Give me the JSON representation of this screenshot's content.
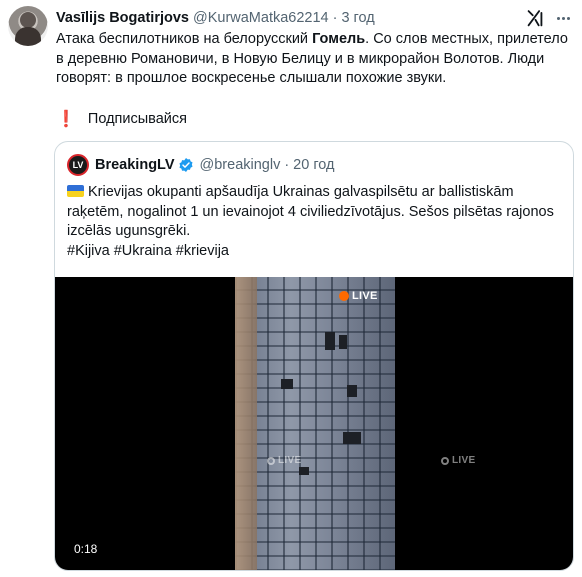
{
  "tweet": {
    "display_name": "Vasīlijs Bogatirjovs",
    "handle": "@KurwaMatka62214",
    "separator": "·",
    "time": "3 год",
    "text_part1": "Атака беспилотников на белорусский ",
    "text_bold": "Гомель",
    "text_part2": ". Со слов местных, прилетело в деревню Романовичи, в Новую Белицу и в микрорайон Волотов. Люди говорят: в прошлое воскресенье слышали похожие звуки.",
    "subscribe_icon": "❗",
    "subscribe_text": "Подписывайся"
  },
  "quote": {
    "display_name": "BreakingLV",
    "avatar_text": "LV",
    "handle": "@breakinglv",
    "separator": "·",
    "time": "20 год",
    "text": "Krievijas okupanti apšaudīja Ukrainas galvaspilsētu ar ballistiskām raķetēm, nogalinot 1 un ievainojot 4 civiliedzīvotājus. Sešos pilsētas rajonos izcēlās ugunsgrēki.",
    "hashtags": "#Kijiva #Ukraina #krievija",
    "video": {
      "live_label": "LIVE",
      "duration": "0:18"
    }
  },
  "icons": {
    "grok": "grok-icon",
    "more": "more-icon",
    "verified": "verified-badge-icon",
    "flag": "ukraine-flag-icon"
  },
  "colors": {
    "text": "#0f1419",
    "secondary": "#536471",
    "verified": "#1d9bf0",
    "border": "#cfd9de",
    "live_accent": "#ff6a00"
  }
}
